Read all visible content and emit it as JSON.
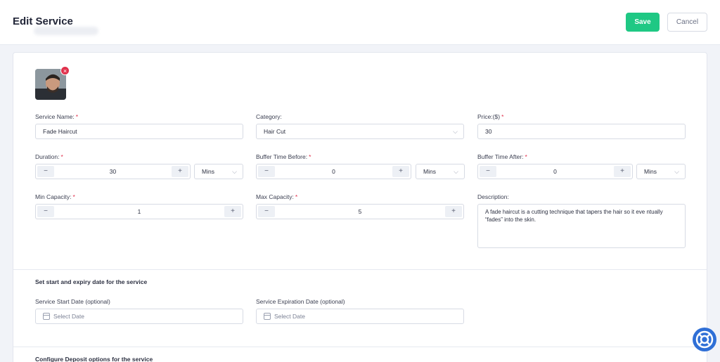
{
  "header": {
    "title": "Edit Service",
    "save_label": "Save",
    "cancel_label": "Cancel"
  },
  "form": {
    "service_name": {
      "label": "Service Name:",
      "required": "*",
      "value": "Fade Haircut"
    },
    "category": {
      "label": "Category:",
      "value": "Hair Cut"
    },
    "price": {
      "label": "Price:($)",
      "required": "*",
      "value": "30"
    },
    "duration": {
      "label": "Duration:",
      "required": "*",
      "value": "30",
      "unit": "Mins"
    },
    "buffer_before": {
      "label": "Buffer Time Before:",
      "required": "*",
      "value": "0",
      "unit": "Mins"
    },
    "buffer_after": {
      "label": "Buffer Time After:",
      "required": "*",
      "value": "0",
      "unit": "Mins"
    },
    "min_capacity": {
      "label": "Min Capacity:",
      "required": "*",
      "value": "1"
    },
    "max_capacity": {
      "label": "Max Capacity:",
      "required": "*",
      "value": "5"
    },
    "description": {
      "label": "Description:",
      "value": "A fade haircut is a cutting technique that tapers the hair so it eve ntually “fades” into the skin."
    }
  },
  "dates": {
    "section_title": "Set start and expiry date for the service",
    "start": {
      "label": "Service Start Date (optional)",
      "placeholder": "Select Date"
    },
    "expiration": {
      "label": "Service Expiration Date (optional)",
      "placeholder": "Select Date"
    }
  },
  "deposit": {
    "section_title": "Configure Deposit options for the service"
  },
  "stepper": {
    "minus": "−",
    "plus": "+"
  },
  "icons": {
    "close": "×",
    "chevron": "⌵"
  },
  "colors": {
    "save": "#1fc884",
    "required": "#e0314c",
    "help": "#2f6fd6"
  }
}
